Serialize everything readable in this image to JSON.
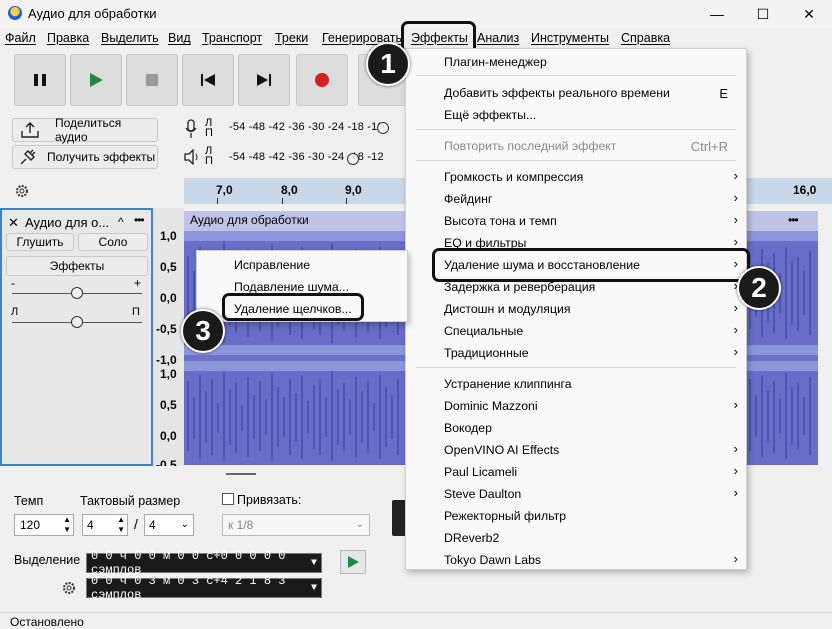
{
  "window": {
    "title": "Аудио для обработки",
    "minimize": "—",
    "maximize": "☐",
    "close": "✕"
  },
  "menubar": [
    "Файл",
    "Правка",
    "Выделить",
    "Вид",
    "Транспорт",
    "Треки",
    "Генерировать",
    "Эффекты",
    "Анализ",
    "Инструменты",
    "Справка"
  ],
  "toolbar": {
    "share_audio": "Поделиться аудио",
    "get_effects": "Получить эффекты"
  },
  "meters": {
    "rec_lr": [
      "Л",
      "П"
    ],
    "play_lr": [
      "Л",
      "П"
    ],
    "rec_scale": "-54 -48 -42 -36 -30 -24 -18 -12",
    "play_scale": "-54 -48 -42 -36 -30 -24 -18 -12"
  },
  "ruler": {
    "ticks": [
      "7,0",
      "8,0",
      "9,0",
      "16,0"
    ]
  },
  "track": {
    "name": "Аудио для о...",
    "mute": "Глушить",
    "solo": "Соло",
    "effects": "Эффекты",
    "gain_minus": "-",
    "gain_plus": "+",
    "pan_left": "Л",
    "pan_right": "П",
    "clip_title": "Аудио для обработки",
    "clip_menu": "•••",
    "clip_menu_right": "•••",
    "scale": [
      "1,0",
      "0,5",
      "0,0",
      "-0,5",
      "-1,0",
      "1,0",
      "0,5",
      "0,0",
      "-0,5"
    ]
  },
  "effects_menu": {
    "items": [
      {
        "label": "Плагин-менеджер",
        "arrow": "",
        "shortcut": ""
      },
      {
        "label": "Добавить эффекты реального времени",
        "arrow": "",
        "shortcut": "E"
      },
      {
        "label": "Ещё эффекты...",
        "arrow": "",
        "shortcut": ""
      },
      {
        "label": "Повторить последний эффект",
        "arrow": "",
        "shortcut": "Ctrl+R",
        "disabled": true
      },
      {
        "label": "Громкость и компрессия",
        "arrow": "›",
        "shortcut": ""
      },
      {
        "label": "Фейдинг",
        "arrow": "›",
        "shortcut": ""
      },
      {
        "label": "Высота тона и темп",
        "arrow": "›",
        "shortcut": ""
      },
      {
        "label": "EQ и фильтры",
        "arrow": "›",
        "shortcut": ""
      },
      {
        "label": "Удаление шума и восстановление",
        "arrow": "›",
        "shortcut": ""
      },
      {
        "label": "Задержка и реверберация",
        "arrow": "›",
        "shortcut": ""
      },
      {
        "label": "Дистошн и модуляция",
        "arrow": "›",
        "shortcut": ""
      },
      {
        "label": "Специальные",
        "arrow": "›",
        "shortcut": ""
      },
      {
        "label": "Традиционные",
        "arrow": "›",
        "shortcut": ""
      },
      {
        "label": "Устранение клиппинга",
        "arrow": "",
        "shortcut": ""
      },
      {
        "label": "Dominic Mazzoni",
        "arrow": "›",
        "shortcut": ""
      },
      {
        "label": "Вокодер",
        "arrow": "",
        "shortcut": ""
      },
      {
        "label": "OpenVINO AI Effects",
        "arrow": "›",
        "shortcut": ""
      },
      {
        "label": "Paul Licameli",
        "arrow": "›",
        "shortcut": ""
      },
      {
        "label": "Steve Daulton",
        "arrow": "›",
        "shortcut": ""
      },
      {
        "label": "Режекторный фильтр",
        "arrow": "",
        "shortcut": ""
      },
      {
        "label": "DReverb2",
        "arrow": "",
        "shortcut": ""
      },
      {
        "label": "Tokyo Dawn Labs",
        "arrow": "›",
        "shortcut": ""
      }
    ]
  },
  "noise_submenu": [
    "Исправление",
    "Подавление шума...",
    "Удаление щелчков..."
  ],
  "bottom": {
    "tempo_label": "Темп",
    "tempo_value": "120",
    "time_sig_label": "Тактовый размер",
    "time_sig_num": "4",
    "time_sig_sep": "/",
    "time_sig_den": "4",
    "snap_label": "Привязать:",
    "snap_value": "к 1/8",
    "selection_label": "Выделение",
    "sel_start": "0 0 ч 0 0 м 0 0 с+0 0 0 0 0  сэмплов",
    "sel_end": "0 0 ч 0 3 м 0 3 с+4 2 1 8 3  сэмплов"
  },
  "status": "Остановлено",
  "badges": [
    "1",
    "2",
    "3"
  ]
}
